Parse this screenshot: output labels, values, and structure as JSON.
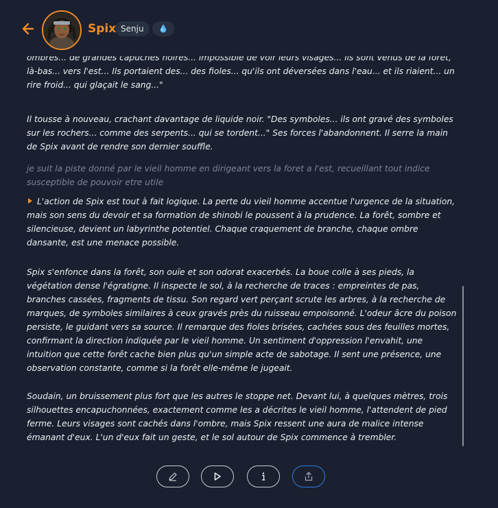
{
  "header": {
    "character_name": "Spix",
    "clan_badge": "Senju",
    "element_icon": "water-drop-icon",
    "accent_color": "#f28c28"
  },
  "story": {
    "paragraphs": [
      {
        "role": "assistant",
        "text": "ombres... de grandes capuches noires... impossible de voir leurs visages... ils sont venus de la forêt, là-bas... vers l'est... Ils portaient des... des fioles... qu'ils ont déversées dans l'eau... et ils riaient... un rire froid... qui glaçait le sang...\""
      },
      {
        "role": "assistant",
        "text": "Il tousse à nouveau, crachant davantage de liquide noir. \"Des symboles... ils ont gravé des symboles sur les rochers... comme des serpents... qui se tordent...\" Ses forces l'abandonnent. Il serre la main de Spix avant de rendre son dernier souffle."
      },
      {
        "role": "user",
        "text": "je suit la piste donné par le vieil homme  en dirigeant vers la foret a l'est, recueillant tout indice susceptible de pouvoir etre utile"
      },
      {
        "role": "assistant",
        "text": "L'action de Spix est tout à fait logique. La perte du vieil homme accentue l'urgence de la situation, mais son sens du devoir et sa formation de shinobi le poussent à la prudence. La forêt, sombre et silencieuse, devient un labyrinthe potentiel. Chaque craquement de branche, chaque ombre dansante, est une menace possible."
      },
      {
        "role": "assistant",
        "text": "Spix s'enfonce dans la forêt, son ouïe et son odorat exacerbés. La boue colle à ses pieds, la végétation dense l'égratigne. Il inspecte le sol, à la recherche de traces : empreintes de pas, branches cassées, fragments de tissu. Son regard vert perçant scrute les arbres, à la recherche de marques, de symboles similaires à ceux gravés près du ruisseau empoisonné. L'odeur âcre du poison persiste, le guidant vers sa source. Il remarque des fioles brisées, cachées sous des feuilles mortes, confirmant la direction indiquée par le vieil homme. Un sentiment d'oppression l'envahit, une intuition que cette forêt cache bien plus qu'un simple acte de sabotage. Il sent une présence, une observation constante, comme si la forêt elle-même le jugeait."
      },
      {
        "role": "assistant",
        "text": "Soudain, un bruissement plus fort que les autres le stoppe net. Devant lui, à quelques mètres, trois silhouettes encapuchonnées, exactement comme les a décrites le vieil homme, l'attendent de pied ferme. Leurs visages sont cachés dans l'ombre, mais Spix ressent une aura de malice intense émanant d'eux. L'un d'eux fait un geste, et le sol autour de Spix commence à trembler."
      }
    ]
  },
  "toolbar": {
    "buttons": [
      {
        "icon": "pencil-icon",
        "name": "edit"
      },
      {
        "icon": "play-icon",
        "name": "play"
      },
      {
        "icon": "info-icon",
        "name": "info"
      },
      {
        "icon": "share-icon",
        "name": "share",
        "color": "#2f7de1"
      }
    ]
  }
}
